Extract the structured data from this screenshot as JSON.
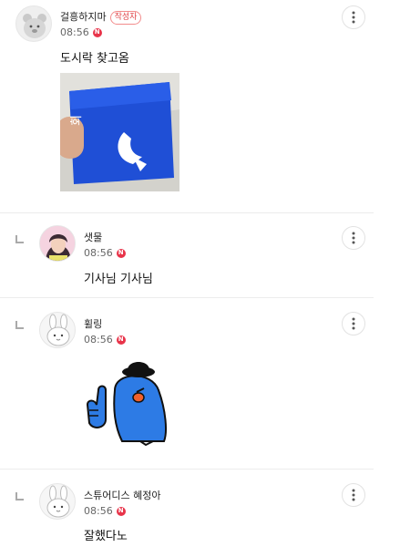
{
  "comments": [
    {
      "author": "걸흥하지마",
      "badge": "작성자",
      "time": "08:56",
      "new_badge": "N",
      "text": "도시락 찾고옴",
      "avatar_icon": "bear-avatar-icon",
      "attachment": "photo-of-blue-pouch"
    },
    {
      "author": "샛물",
      "time": "08:56",
      "new_badge": "N",
      "text": "기사님 기사님",
      "avatar_icon": "profile-photo-avatar",
      "is_reply": true
    },
    {
      "author": "휠링",
      "time": "08:56",
      "new_badge": "N",
      "text": "",
      "avatar_icon": "rabbit-avatar-icon",
      "attachment": "blue-character-thumbs-up-sticker",
      "is_reply": true
    },
    {
      "author": "스튜어디스 혜정아",
      "time": "08:56",
      "new_badge": "N",
      "text": "잘했다노",
      "avatar_icon": "rabbit-avatar-icon",
      "is_reply": true
    }
  ],
  "colors": {
    "new_badge": "#e8344a",
    "author_badge_border": "#f28c8c",
    "sticker_blue": "#2d7be5",
    "pouch_blue": "#1f4fd6"
  }
}
